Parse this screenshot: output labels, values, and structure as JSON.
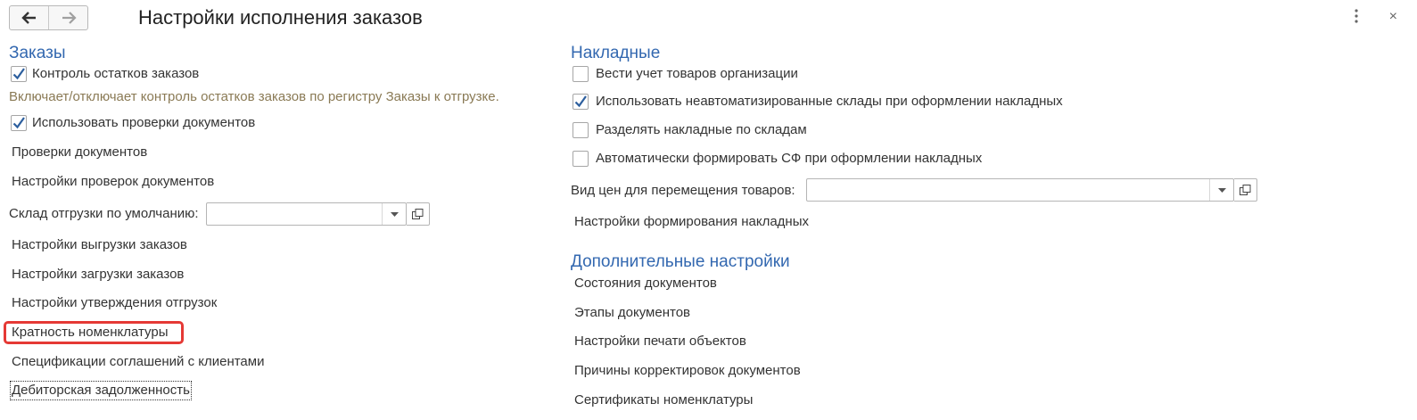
{
  "header": {
    "title": "Настройки исполнения заказов",
    "back_icon": "arrow-left-icon",
    "forward_icon": "arrow-right-icon",
    "menu_icon": "more-vertical-icon",
    "close_icon": "close-icon",
    "close_glyph": "×"
  },
  "left": {
    "section_title": "Заказы",
    "orders_control": {
      "label": "Контроль остатков заказов",
      "checked": true
    },
    "orders_control_hint": "Включает/отключает контроль остатков заказов по регистру Заказы к отгрузке.",
    "use_checks": {
      "label": "Использовать проверки документов",
      "checked": true
    },
    "links": [
      "Проверки документов",
      "Настройки проверок документов"
    ],
    "warehouse_label": "Склад отгрузки по умолчанию:",
    "warehouse_value": "",
    "links2": [
      "Настройки выгрузки заказов",
      "Настройки загрузки заказов",
      "Настройки утверждения отгрузок",
      "Кратность номенклатуры",
      "Спецификации соглашений с клиентами",
      "Дебиторская задолженность"
    ]
  },
  "right": {
    "section_title": "Накладные",
    "options": [
      {
        "label": "Вести учет товаров организации",
        "checked": false
      },
      {
        "label": "Использовать неавтоматизированные склады при оформлении накладных",
        "checked": true
      },
      {
        "label": "Разделять накладные по складам",
        "checked": false
      },
      {
        "label": "Автоматически формировать СФ при оформлении накладных",
        "checked": false
      }
    ],
    "price_type_label": "Вид цен для перемещения товаров:",
    "price_type_value": "",
    "invoice_settings_link": "Настройки формирования накладных",
    "extra_title": "Дополнительные настройки",
    "extra_links": [
      "Состояния документов",
      "Этапы документов",
      "Настройки печати объектов",
      "Причины корректировок документов",
      "Сертификаты номенклатуры"
    ]
  },
  "colors": {
    "section": "#3368b0",
    "hint": "#8a7a55",
    "highlight": "#e53935",
    "check": "#2d5f9e"
  }
}
